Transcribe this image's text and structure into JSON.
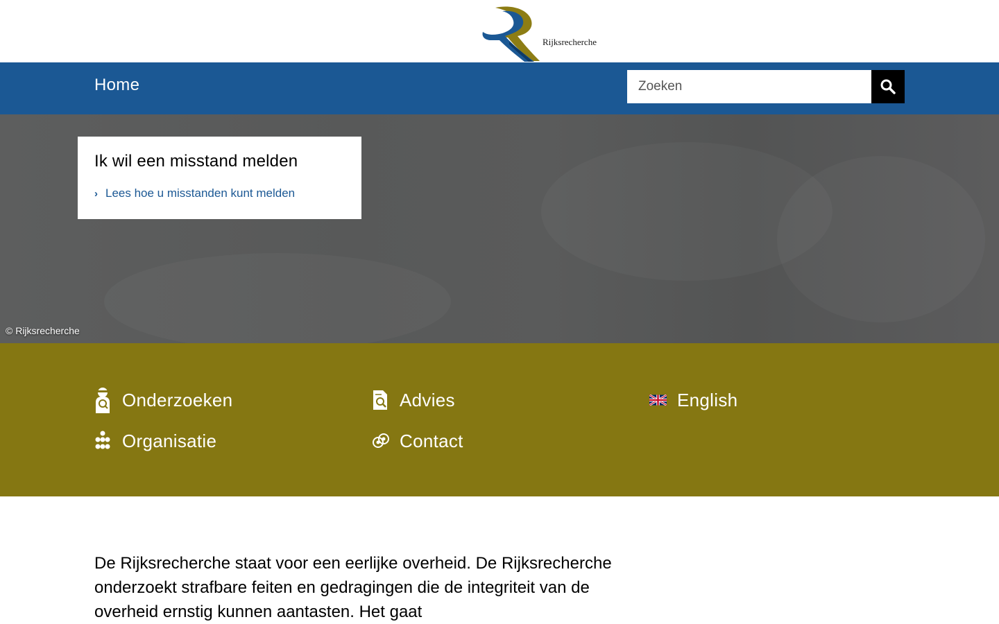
{
  "header": {
    "logo_text": "Rijksrecherche",
    "brand_colors": {
      "blue": "#1b5894",
      "gold": "#857712"
    }
  },
  "nav": {
    "home_label": "Home",
    "search": {
      "placeholder": "Zoeken",
      "value": "",
      "button_icon": "search-icon"
    }
  },
  "hero": {
    "card_title": "Ik wil een misstand melden",
    "card_link": "Lees hoe u misstanden kunt melden",
    "credit": "© Rijksrecherche"
  },
  "quicklinks": {
    "background": "#857712",
    "items": [
      {
        "label": "Onderzoeken",
        "icon": "investigator-icon"
      },
      {
        "label": "Advies",
        "icon": "document-search-icon"
      },
      {
        "label": "English",
        "icon": "uk-flag-icon"
      },
      {
        "label": "Organisatie",
        "icon": "organisation-icon"
      },
      {
        "label": "Contact",
        "icon": "contact-icon"
      }
    ]
  },
  "intro": {
    "text": "De Rijksrecherche staat voor een eerlijke overheid. De Rijksrecherche onderzoekt strafbare feiten en gedragingen die de integriteit van de overheid ernstig kunnen aantasten. Het gaat"
  }
}
